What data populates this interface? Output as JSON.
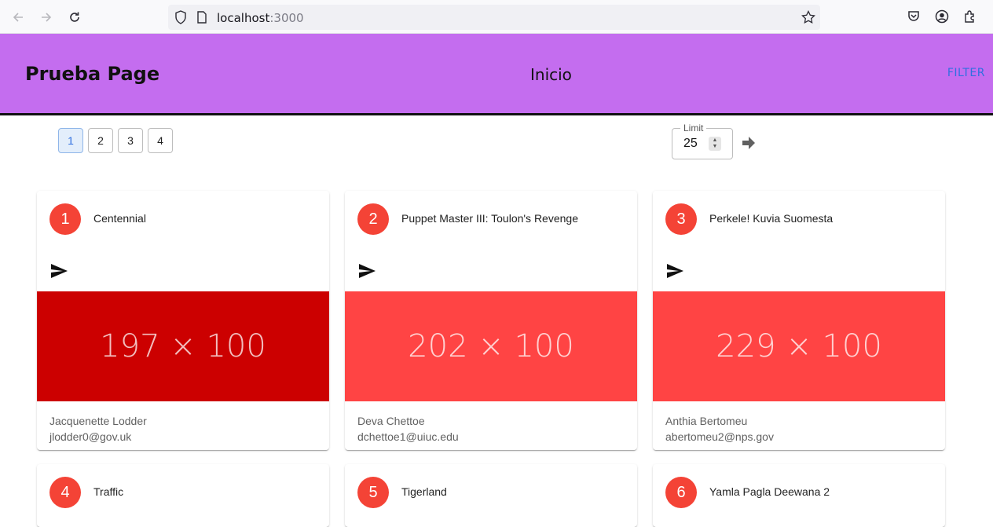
{
  "browser": {
    "url_host": "localhost",
    "url_port": ":3000"
  },
  "header": {
    "title": "Prueba Page",
    "nav_link": "Inicio",
    "filter_label": "FILTER",
    "background": "#c46def"
  },
  "pagination": {
    "pages": [
      "1",
      "2",
      "3",
      "4"
    ],
    "active": "1"
  },
  "limit": {
    "label": "Limit",
    "value": "25"
  },
  "cards": [
    {
      "number": "1",
      "title": "Centennial",
      "media_text": "197 × 100",
      "media_color": "#cc0000",
      "owner": "Jacquenette Lodder",
      "email": "jlodder0@gov.uk"
    },
    {
      "number": "2",
      "title": "Puppet Master III: Toulon's Revenge",
      "media_text": "202 × 100",
      "media_color": "#ff4444",
      "owner": "Deva Chettoe",
      "email": "dchettoe1@uiuc.edu"
    },
    {
      "number": "3",
      "title": "Perkele! Kuvia Suomesta",
      "media_text": "229 × 100",
      "media_color": "#ff4444",
      "owner": "Anthia Bertomeu",
      "email": "abertomeu2@nps.gov"
    },
    {
      "number": "4",
      "title": "Traffic"
    },
    {
      "number": "5",
      "title": "Tigerland"
    },
    {
      "number": "6",
      "title": "Yamla Pagla Deewana 2"
    }
  ],
  "icons": {
    "back": "arrow-left-icon",
    "forward": "arrow-right-icon",
    "reload": "reload-icon",
    "shield": "shield-icon",
    "page": "page-icon",
    "star": "star-icon",
    "pocket": "pocket-icon",
    "account": "account-icon",
    "extensions": "extensions-icon",
    "send": "send-icon",
    "go": "arrow-go-icon"
  }
}
